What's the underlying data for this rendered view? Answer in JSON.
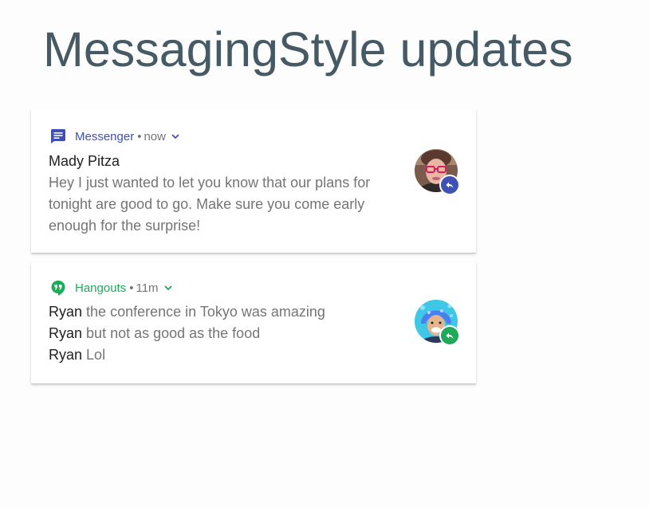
{
  "slide": {
    "title": "MessagingStyle updates"
  },
  "notifications": [
    {
      "app_name": "Messenger",
      "separator": "•",
      "time": "now",
      "app_icon": "messenger-icon",
      "accent_color": "#3f51b5",
      "sender": "Mady Pitza",
      "message": "Hey I just wanted to let you know that our plans for tonight are good to go. Make sure you come early enough for the surprise!",
      "badge_icon": "reply-icon"
    },
    {
      "app_name": "Hangouts",
      "separator": "•",
      "time": "11m",
      "app_icon": "hangouts-icon",
      "accent_color": "#1faa59",
      "messages": [
        {
          "sender": "Ryan",
          "text": "the conference in Tokyo was amazing"
        },
        {
          "sender": "Ryan",
          "text": "but not as good as the food"
        },
        {
          "sender": "Ryan",
          "text": "Lol"
        }
      ],
      "badge_icon": "reply-icon"
    }
  ]
}
